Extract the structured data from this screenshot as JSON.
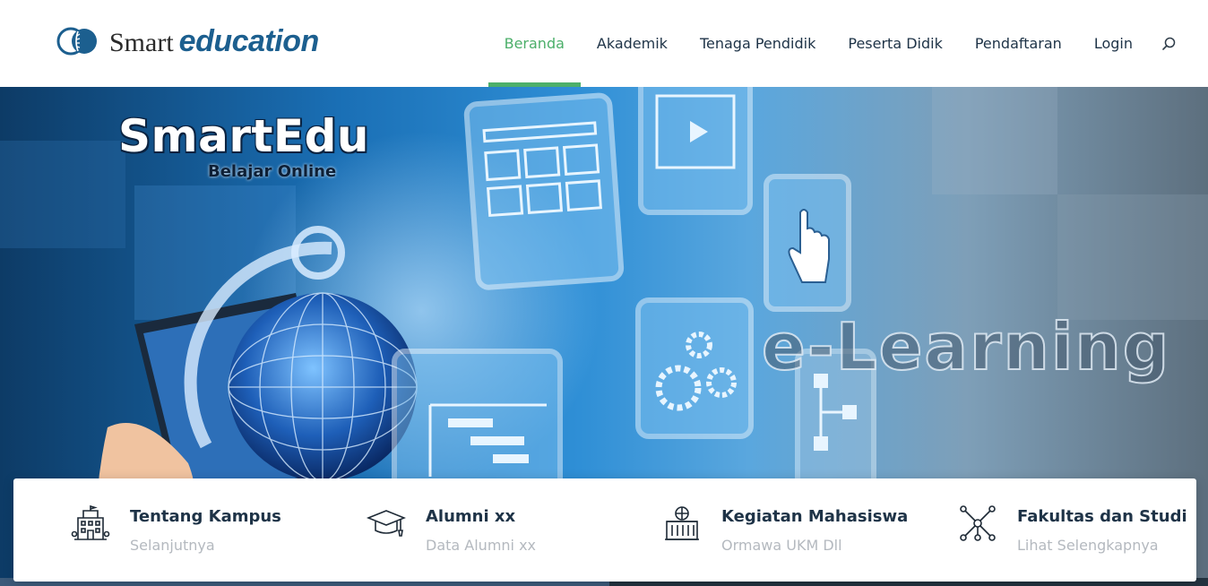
{
  "header": {
    "logo": {
      "word1": "Smart",
      "word2": "education"
    },
    "nav": [
      {
        "label": "Beranda",
        "active": true
      },
      {
        "label": "Akademik",
        "active": false
      },
      {
        "label": "Tenaga Pendidik",
        "active": false
      },
      {
        "label": "Peserta Didik",
        "active": false
      },
      {
        "label": "Pendaftaran",
        "active": false
      },
      {
        "label": "Login",
        "active": false
      }
    ],
    "search_icon": "search-icon"
  },
  "hero": {
    "brand_title": "SmartEdu",
    "brand_subtitle": "Belajar Online",
    "overlay_text": "e-Learning"
  },
  "features": [
    {
      "title": "Tentang Kampus",
      "subtitle": "Selanjutnya",
      "icon": "campus-building-icon"
    },
    {
      "title": "Alumni xx",
      "subtitle": "Data Alumni xx",
      "icon": "graduation-cap-icon"
    },
    {
      "title": "Kegiatan Mahasiswa",
      "subtitle": "Ormawa UKM Dll",
      "icon": "student-activity-icon"
    },
    {
      "title": "Fakultas dan Studi",
      "subtitle": "Lihat Selengkapnya",
      "icon": "network-icon"
    }
  ],
  "colors": {
    "accent": "#4caf6a",
    "nav_text": "#1e3347",
    "brand_blue": "#1c5f8f",
    "muted_text": "#b4b9bf"
  }
}
